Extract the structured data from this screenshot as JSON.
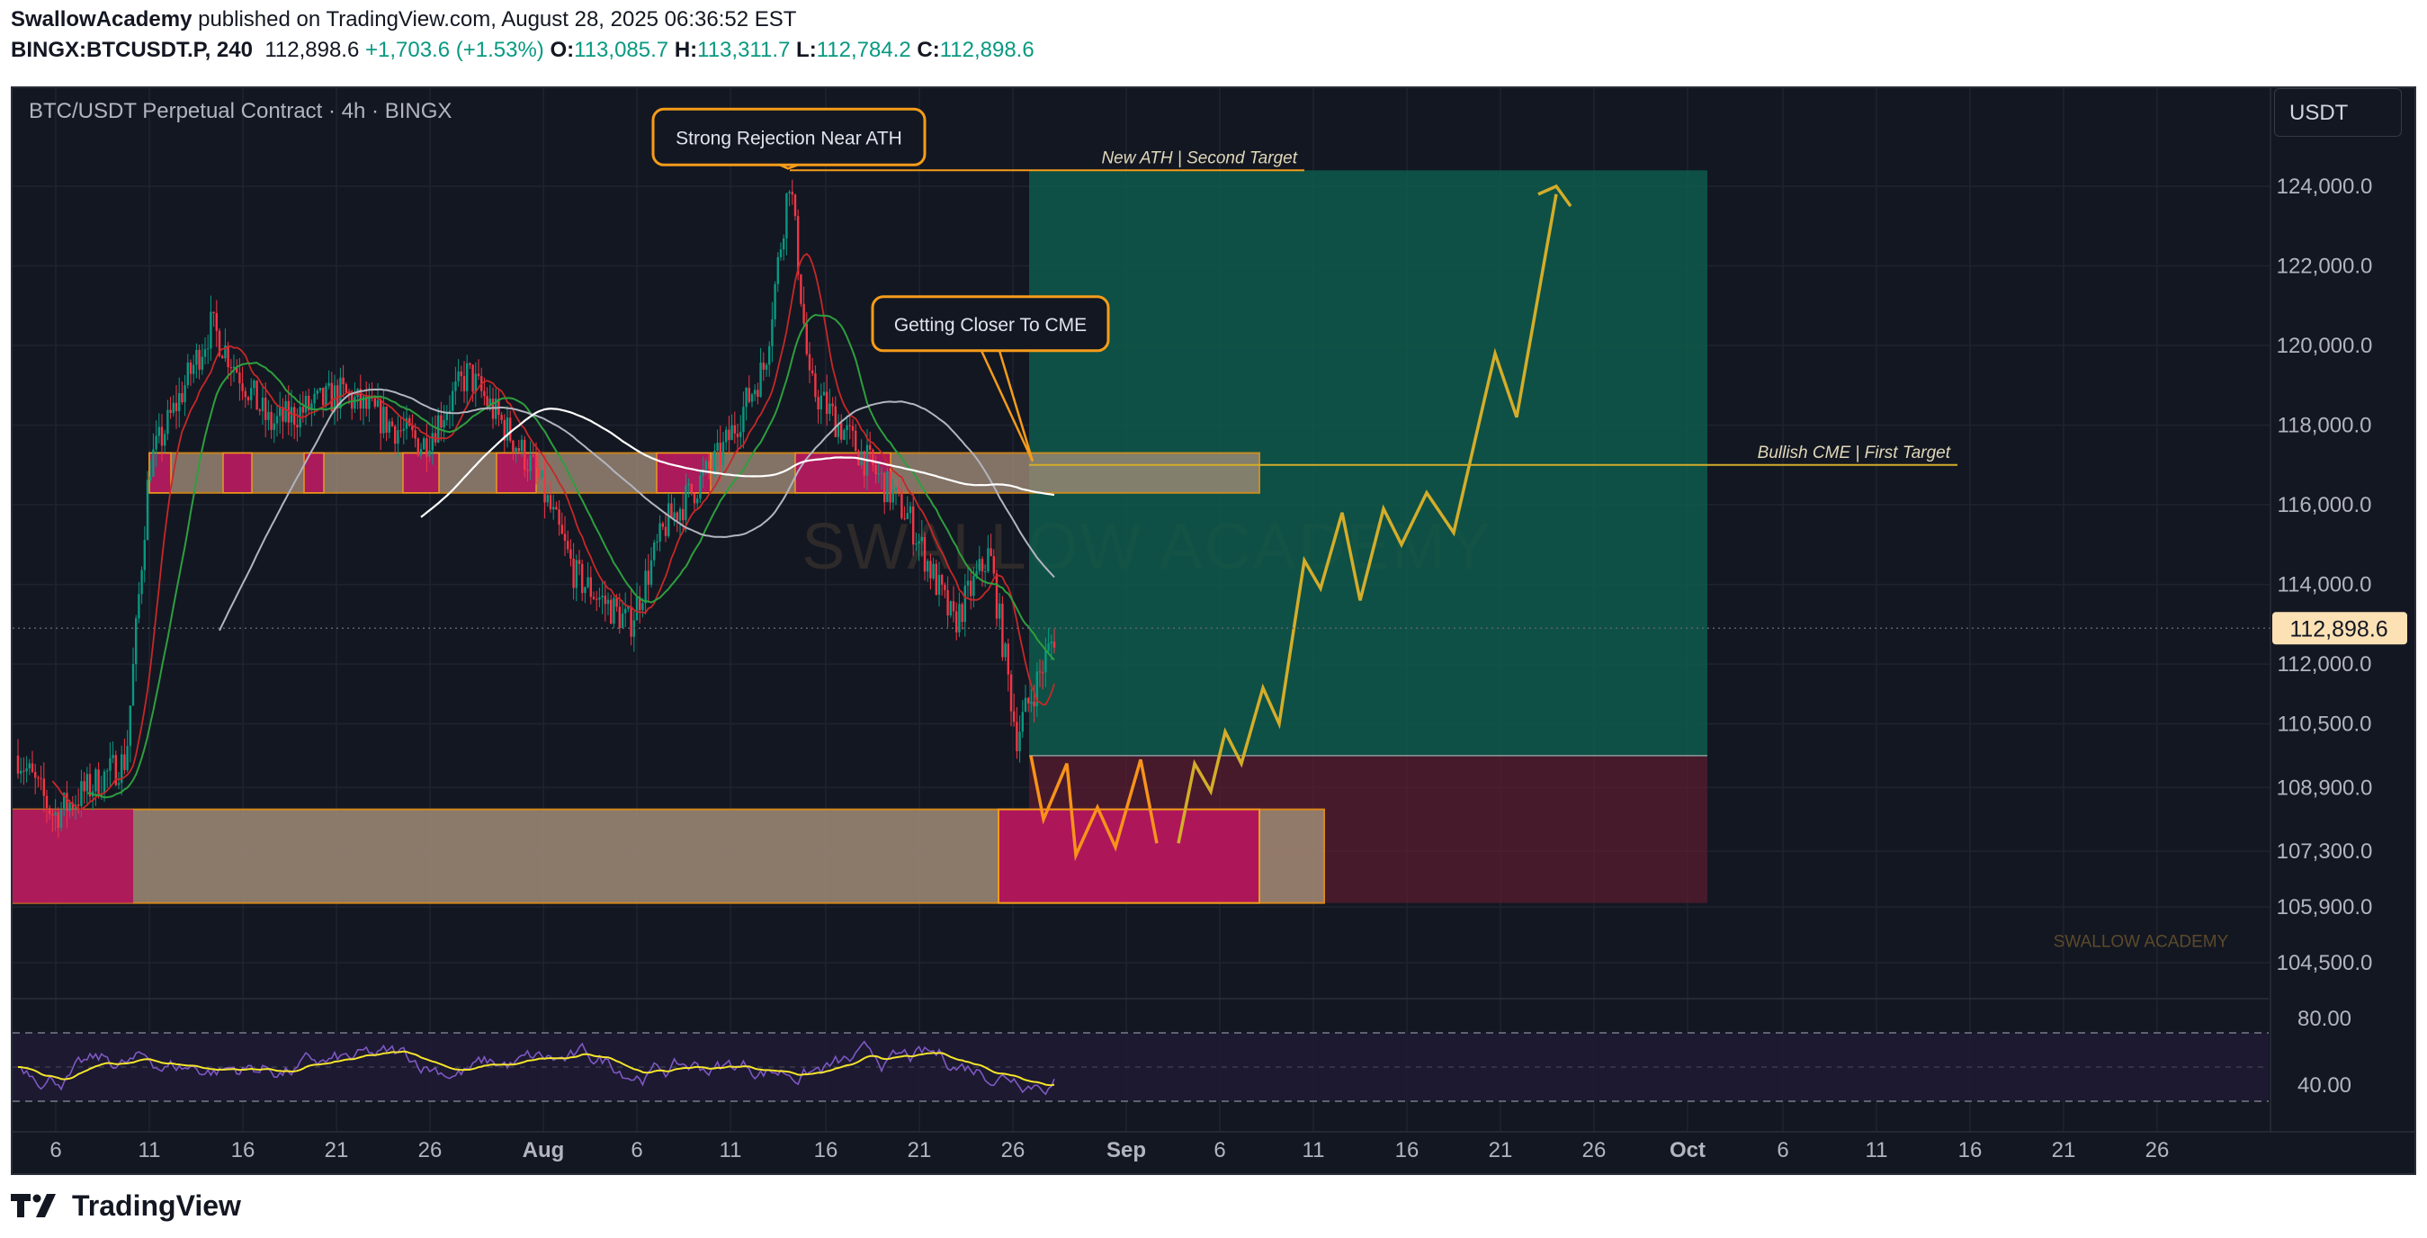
{
  "header": {
    "author": "SwallowAcademy",
    "published": "published on TradingView.com, August 28, 2025 06:36:52 EST",
    "symbol": "BINGX:BTCUSDT.P, 240",
    "last": "112,898.6",
    "change": "+1,703.6 (+1.53%)",
    "o_label": "O:",
    "o_val": "113,085.7",
    "h_label": "H:",
    "h_val": "113,311.7",
    "l_label": "L:",
    "l_val": "112,784.2",
    "c_label": "C:",
    "c_val": "112,898.6"
  },
  "chart_title": "BTC/USDT Perpetual Contract · 4h · BINGX",
  "currency": "USDT",
  "watermark": "SWALLOW ACADEMY",
  "watermark_small": "SWALLOW ACADEMY",
  "footer": {
    "brand": "TradingView"
  },
  "colors": {
    "bg": "#131722",
    "up": "#089981",
    "down": "#f23645",
    "target_zone": "#0e5b4b",
    "stop_zone": "#5c1d2d",
    "zone_fill": "#a08b77",
    "zone_border": "#f59c1a",
    "zone_magenta": "#b0115a",
    "projection": "#d4ad2a",
    "projection_orange": "#f7931a",
    "rsi": "#7e57c2",
    "rsi_ma": "#f5e42c"
  },
  "chart_data": {
    "type": "candlestick",
    "title": "BTC/USDT Perpetual Contract · 4h · BINGX",
    "y_axis": {
      "ticks": [
        124000,
        122000,
        120000,
        118000,
        116000,
        114000,
        112000,
        110500,
        108900,
        107300,
        105900,
        104500
      ],
      "tick_labels": [
        "124,000.0",
        "122,000.0",
        "120,000.0",
        "118,000.0",
        "116,000.0",
        "114,000.0",
        "112,000.0",
        "110,500.0",
        "108,900.0",
        "107,300.0",
        "105,900.0",
        "104,500.0"
      ],
      "current_price": 112898.6,
      "current_label": "112,898.6"
    },
    "x_axis": {
      "tick_labels": [
        "6",
        "11",
        "16",
        "21",
        "26",
        "Aug",
        "6",
        "11",
        "16",
        "21",
        "26",
        "Sep",
        "6",
        "11",
        "16",
        "21",
        "26",
        "Oct",
        "6",
        "11",
        "16",
        "21",
        "26"
      ]
    },
    "annotations": [
      {
        "text": "Strong Rejection Near ATH",
        "price": 124400
      },
      {
        "text": "Getting Closer To CME",
        "price": 117000
      },
      {
        "text": "New ATH | Second Target",
        "price": 124400
      },
      {
        "text": "Bullish CME | First Target",
        "price": 117000
      }
    ],
    "zones": {
      "supply_zone": [
        116300,
        117300
      ],
      "demand_zone": [
        106000,
        108350
      ],
      "target_zone": [
        109700,
        124400
      ],
      "stop_zone": [
        106000,
        109700
      ]
    },
    "projection": {
      "orange_path": [
        109700,
        108100,
        109500,
        107200,
        108400,
        107400,
        109600,
        107500
      ],
      "gold_path": [
        107500,
        109500,
        108800,
        110300,
        109500,
        111400,
        110500,
        114600,
        113900,
        115800,
        113600,
        115900,
        115000,
        116300,
        115300,
        119800,
        118200,
        123800
      ]
    },
    "rsi": {
      "levels": [
        80,
        40
      ],
      "level_labels": [
        "80.00",
        "40.00"
      ]
    }
  }
}
